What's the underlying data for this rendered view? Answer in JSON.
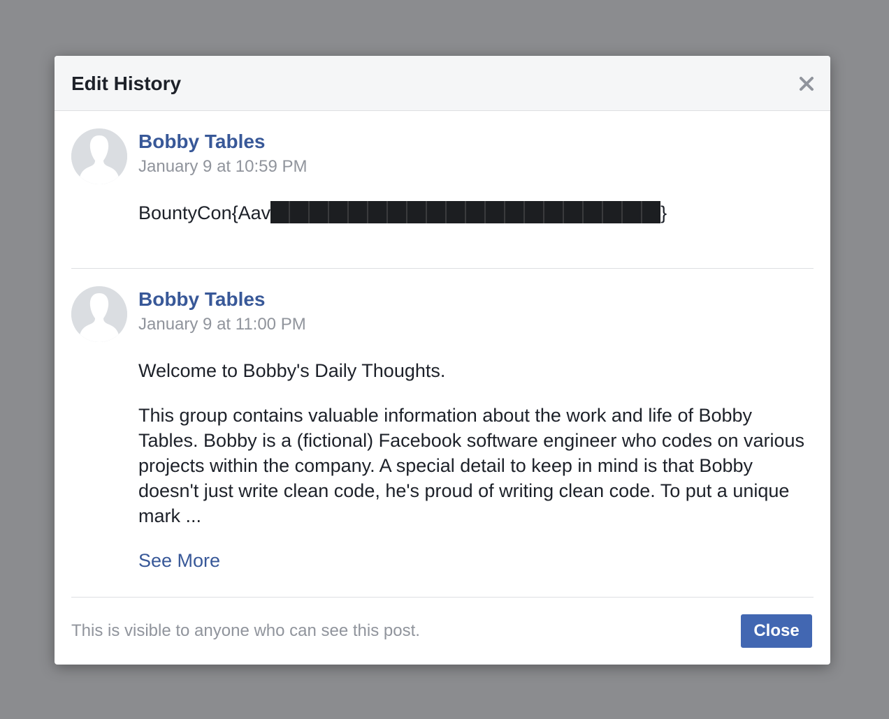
{
  "dialog": {
    "title": "Edit History",
    "close_icon": "close-icon"
  },
  "entries": [
    {
      "author": "Bobby Tables",
      "timestamp": "January 9 at 10:59 PM",
      "text_prefix": "BountyCon{Aav",
      "text_suffix": "}",
      "avatar_icon": "default-avatar-icon"
    },
    {
      "author": "Bobby Tables",
      "timestamp": "January 9 at 11:00 PM",
      "paragraph1": "Welcome to Bobby's Daily Thoughts.",
      "paragraph2": "This group contains valuable information about the work and life of Bobby Tables. Bobby is a (fictional) Facebook software engineer who codes on various projects within the company. A special detail to keep in mind is that Bobby doesn't just write clean code, he's proud of writing clean code. To put a unique mark ...",
      "see_more": "See More",
      "avatar_icon": "default-avatar-icon"
    }
  ],
  "footer": {
    "visibility_text": "This is visible to anyone who can see this post.",
    "close_label": "Close"
  },
  "colors": {
    "link": "#385898",
    "button": "#4267b2",
    "overlay": "#8b8c8f"
  }
}
